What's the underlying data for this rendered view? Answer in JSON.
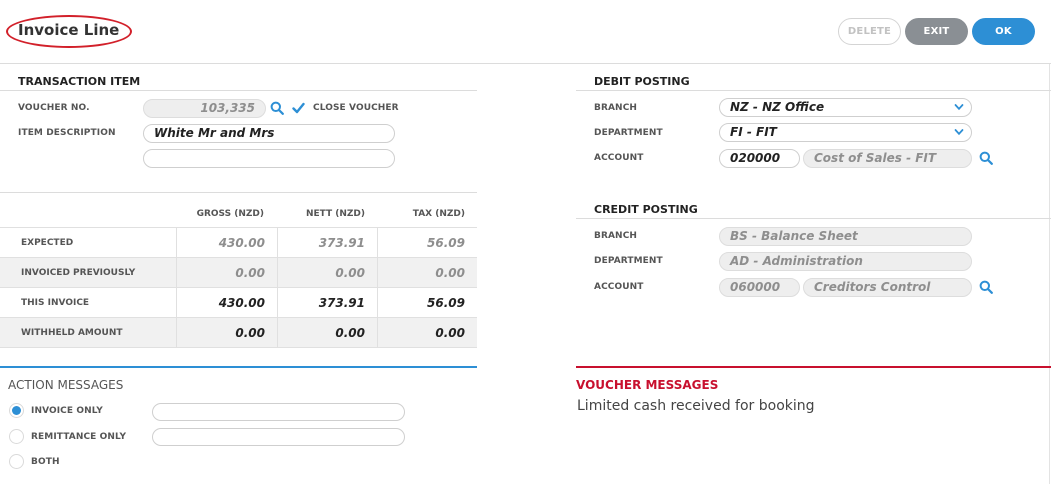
{
  "header": {
    "title": "Invoice Line",
    "delete_label": "DELETE",
    "exit_label": "EXIT",
    "ok_label": "OK"
  },
  "transaction": {
    "heading": "TRANSACTION ITEM",
    "voucher_label": "VOUCHER NO.",
    "voucher_value": "103,335",
    "close_voucher_label": "CLOSE VOUCHER",
    "close_voucher_checked": true,
    "item_desc_label": "ITEM DESCRIPTION",
    "item_desc_value": "White Mr and Mrs",
    "item_desc_line2": ""
  },
  "amounts": {
    "columns": [
      "GROSS (NZD)",
      "NETT (NZD)",
      "TAX (NZD)"
    ],
    "rows": [
      {
        "label": "EXPECTED",
        "gross": "430.00",
        "nett": "373.91",
        "tax": "56.09"
      },
      {
        "label": "INVOICED PREVIOUSLY",
        "gross": "0.00",
        "nett": "0.00",
        "tax": "0.00"
      },
      {
        "label": "THIS INVOICE",
        "gross": "430.00",
        "nett": "373.91",
        "tax": "56.09"
      },
      {
        "label": "WITHHELD AMOUNT",
        "gross": "0.00",
        "nett": "0.00",
        "tax": "0.00"
      }
    ]
  },
  "debit": {
    "heading": "DEBIT POSTING",
    "branch_label": "BRANCH",
    "branch_value": "NZ - NZ Office",
    "department_label": "DEPARTMENT",
    "department_value": "FI - FIT",
    "account_label": "ACCOUNT",
    "account_code": "020000",
    "account_name": "Cost of Sales - FIT"
  },
  "credit": {
    "heading": "CREDIT POSTING",
    "branch_label": "BRANCH",
    "branch_value": "BS - Balance Sheet",
    "department_label": "DEPARTMENT",
    "department_value": "AD - Administration",
    "account_label": "ACCOUNT",
    "account_code": "060000",
    "account_name": "Creditors Control"
  },
  "action_messages": {
    "heading": "ACTION MESSAGES",
    "options": [
      {
        "label": "INVOICE ONLY",
        "selected": true
      },
      {
        "label": "REMITTANCE ONLY",
        "selected": false
      },
      {
        "label": "BOTH",
        "selected": false
      }
    ]
  },
  "voucher_messages": {
    "heading": "VOUCHER MESSAGES",
    "text": "Limited cash received for booking"
  },
  "colors": {
    "accent": "#2d8fd5",
    "alert": "#c8102e",
    "exit_button": "#8a8f94"
  },
  "icons": [
    "search-icon",
    "check-icon",
    "chevron-down-icon"
  ]
}
